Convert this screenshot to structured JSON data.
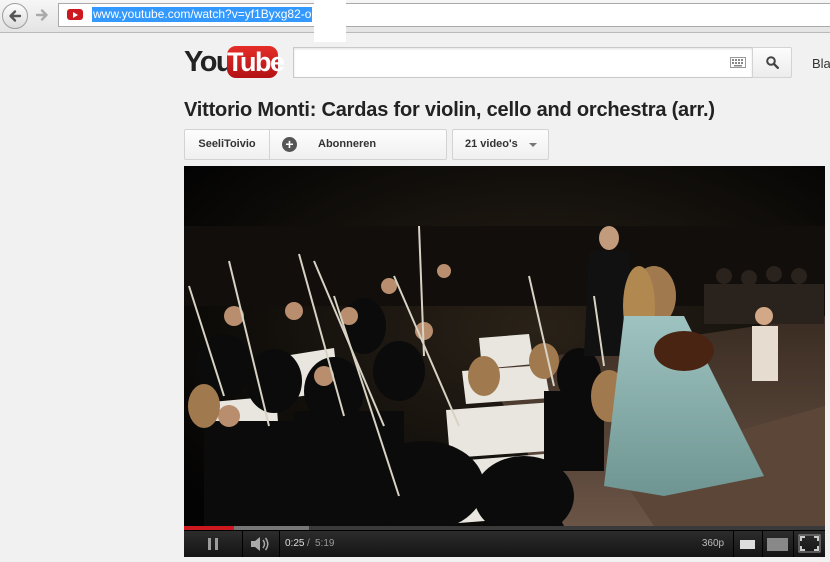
{
  "browser": {
    "url": "www.youtube.com/watch?v=yf1Byxg82-o"
  },
  "header": {
    "logo_you": "You",
    "logo_tube": "Tube",
    "search_placeholder": "",
    "browse_label": "Bla"
  },
  "video": {
    "title": "Vittorio Monti: Cardas for violin, cello and orchestra (arr.)",
    "channel_name": "SeeliToivio",
    "subscribe_label": "Abonneren",
    "playlist_label": "21 video's"
  },
  "player": {
    "current_time": "0:25",
    "separator": "/",
    "total_time": "5:19",
    "quality": "360p",
    "progress_fraction": 0.078,
    "loaded_fraction": 0.195,
    "colors": {
      "played": "#cc181e",
      "loaded": "#777777",
      "track": "#3a3a3a"
    }
  },
  "icons": {
    "back": "back-arrow-icon",
    "forward": "forward-arrow-icon",
    "favicon": "youtube-favicon-icon",
    "keyboard": "keyboard-icon",
    "search": "search-icon",
    "subscribe": "plus-icon",
    "playlist": "caret-down-icon",
    "pause": "pause-icon",
    "volume": "speaker-icon",
    "fullscreen": "fullscreen-icon"
  }
}
